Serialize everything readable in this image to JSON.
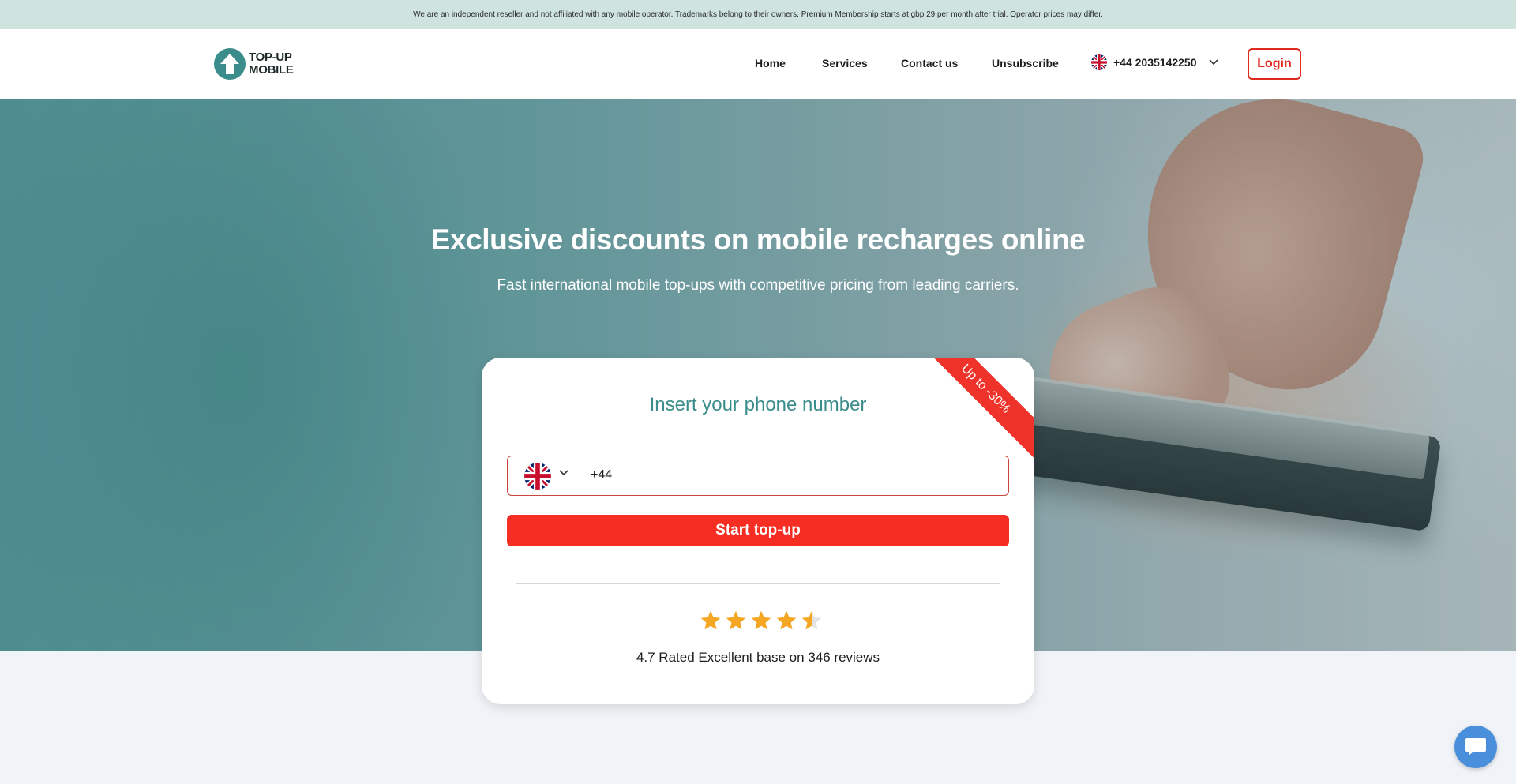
{
  "notice": {
    "text": "We are an independent reseller and not affiliated with any mobile operator. Trademarks belong to their owners. Premium Membership starts at gbp 29 per month after trial. Operator prices may differ."
  },
  "header": {
    "logo_line1": "TOP-UP",
    "logo_line2": "MOBILE",
    "nav": [
      {
        "label": "Home"
      },
      {
        "label": "Services"
      },
      {
        "label": "Contact us"
      },
      {
        "label": "Unsubscribe"
      }
    ],
    "phone_selector": "+44 2035142250",
    "login_label": "Login"
  },
  "hero": {
    "title": "Exclusive discounts on mobile recharges online",
    "subtitle": "Fast international mobile top-ups with competitive pricing from leading carriers."
  },
  "card": {
    "ribbon": "Up to -30%",
    "title": "Insert your phone number",
    "phone_prefix": "+44",
    "cta": "Start top-up",
    "rating_stars": 4.5,
    "rating_text": "4.7 Rated Excellent base on 346 reviews"
  },
  "colors": {
    "accent_teal": "#3a8d8a",
    "cta_red": "#f52d22",
    "star": "#f5a623",
    "chat_blue": "#4a8fdc"
  },
  "icons": {
    "logo": "upload-arrow-icon",
    "flag": "uk-flag-icon",
    "chevron": "chevron-down-icon",
    "star": "star-icon",
    "chat": "chat-bubble-icon"
  }
}
